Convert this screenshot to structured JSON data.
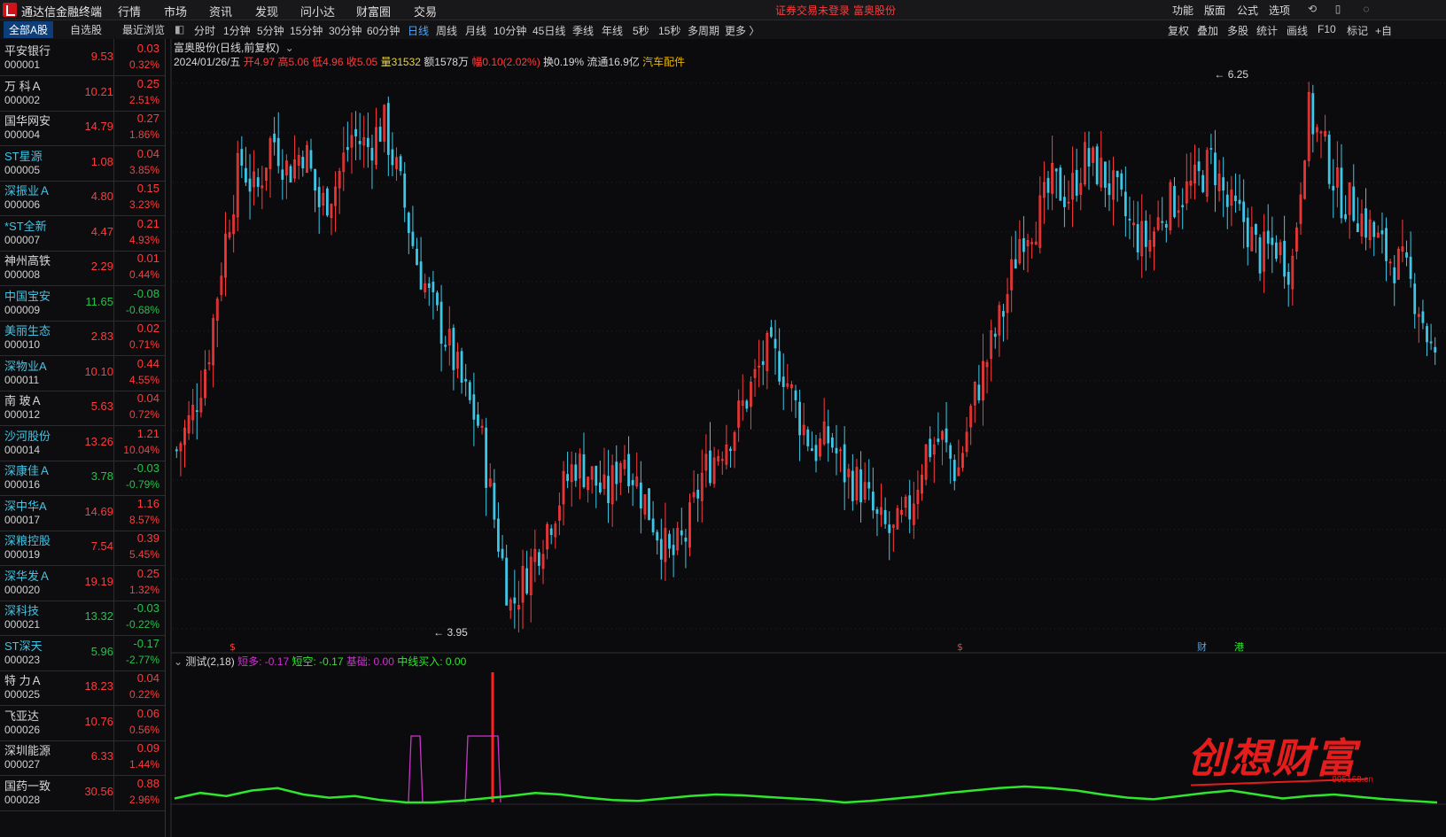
{
  "app": {
    "title": "通达信金融终端"
  },
  "menu": [
    "行情",
    "市场",
    "资讯",
    "发现",
    "问小达",
    "财富圈",
    "交易"
  ],
  "status": {
    "login_warning": "证券交易未登录",
    "current_stock": "富奥股份"
  },
  "right_menu": [
    "功能",
    "版面",
    "公式",
    "选项"
  ],
  "left_tabs": [
    "全部A股",
    "自选股",
    "最近浏览"
  ],
  "periods": [
    "分时",
    "1分钟",
    "5分钟",
    "15分钟",
    "30分钟",
    "60分钟",
    "日线",
    "周线",
    "月线",
    "10分钟",
    "45日线",
    "季线",
    "年线",
    "5秒",
    "15秒",
    "多周期",
    "更多 〉"
  ],
  "active_period": "日线",
  "right_tools": [
    "复权",
    "叠加",
    "多股",
    "统计",
    "画线",
    "F10",
    "标记",
    "+自"
  ],
  "stocks": [
    {
      "name": "平安银行",
      "code": "000001",
      "price": "9.53",
      "change": "0.03",
      "pct": "0.32%",
      "dir": "up",
      "name_color": "white"
    },
    {
      "name": "万 科Ａ",
      "code": "000002",
      "price": "10.21",
      "change": "0.25",
      "pct": "2.51%",
      "dir": "up",
      "name_color": "white"
    },
    {
      "name": "国华网安",
      "code": "000004",
      "price": "14.79",
      "change": "0.27",
      "pct": "1.86%",
      "dir": "up",
      "name_color": "white"
    },
    {
      "name": "ST星源",
      "code": "000005",
      "price": "1.08",
      "change": "0.04",
      "pct": "3.85%",
      "dir": "up",
      "name_color": "cyan"
    },
    {
      "name": "深振业Ａ",
      "code": "000006",
      "price": "4.80",
      "change": "0.15",
      "pct": "3.23%",
      "dir": "up",
      "name_color": "cyan"
    },
    {
      "name": "*ST全新",
      "code": "000007",
      "price": "4.47",
      "change": "0.21",
      "pct": "4.93%",
      "dir": "up",
      "name_color": "cyan"
    },
    {
      "name": "神州高铁",
      "code": "000008",
      "price": "2.29",
      "change": "0.01",
      "pct": "0.44%",
      "dir": "up",
      "name_color": "white"
    },
    {
      "name": "中国宝安",
      "code": "000009",
      "price": "11.65",
      "change": "-0.08",
      "pct": "-0.68%",
      "dir": "dn",
      "name_color": "cyan"
    },
    {
      "name": "美丽生态",
      "code": "000010",
      "price": "2.83",
      "change": "0.02",
      "pct": "0.71%",
      "dir": "up",
      "name_color": "cyan"
    },
    {
      "name": "深物业A",
      "code": "000011",
      "price": "10.10",
      "change": "0.44",
      "pct": "4.55%",
      "dir": "up",
      "name_color": "cyan"
    },
    {
      "name": "南 玻Ａ",
      "code": "000012",
      "price": "5.63",
      "change": "0.04",
      "pct": "0.72%",
      "dir": "up",
      "name_color": "white"
    },
    {
      "name": "沙河股份",
      "code": "000014",
      "price": "13.26",
      "change": "1.21",
      "pct": "10.04%",
      "dir": "up",
      "name_color": "cyan"
    },
    {
      "name": "深康佳Ａ",
      "code": "000016",
      "price": "3.78",
      "change": "-0.03",
      "pct": "-0.79%",
      "dir": "dn",
      "name_color": "cyan"
    },
    {
      "name": "深中华A",
      "code": "000017",
      "price": "14.69",
      "change": "1.16",
      "pct": "8.57%",
      "dir": "up",
      "name_color": "cyan"
    },
    {
      "name": "深粮控股",
      "code": "000019",
      "price": "7.54",
      "change": "0.39",
      "pct": "5.45%",
      "dir": "up",
      "name_color": "cyan"
    },
    {
      "name": "深华发Ａ",
      "code": "000020",
      "price": "19.19",
      "change": "0.25",
      "pct": "1.32%",
      "dir": "up",
      "name_color": "cyan"
    },
    {
      "name": "深科技",
      "code": "000021",
      "price": "13.32",
      "change": "-0.03",
      "pct": "-0.22%",
      "dir": "dn",
      "name_color": "cyan"
    },
    {
      "name": "ST深天",
      "code": "000023",
      "price": "5.96",
      "change": "-0.17",
      "pct": "-2.77%",
      "dir": "dn",
      "name_color": "cyan"
    },
    {
      "name": "特 力Ａ",
      "code": "000025",
      "price": "18.23",
      "change": "0.04",
      "pct": "0.22%",
      "dir": "up",
      "name_color": "white"
    },
    {
      "name": "飞亚达",
      "code": "000026",
      "price": "10.76",
      "change": "0.06",
      "pct": "0.56%",
      "dir": "up",
      "name_color": "white"
    },
    {
      "name": "深圳能源",
      "code": "000027",
      "price": "6.33",
      "change": "0.09",
      "pct": "1.44%",
      "dir": "up",
      "name_color": "white"
    },
    {
      "name": "国药一致",
      "code": "000028",
      "price": "30.56",
      "change": "0.88",
      "pct": "2.96%",
      "dir": "up",
      "name_color": "white"
    }
  ],
  "chart_header": {
    "title": "富奥股份(日线,前复权)",
    "date": "2024/01/26/五",
    "open": "开4.97",
    "high": "高5.06",
    "low": "低4.96",
    "close": "收5.05",
    "volume": "量31532",
    "amount": "额1578万",
    "range": "幅0.10(2.02%)",
    "turnover": "换0.19%",
    "float": "流通16.9亿",
    "sector": "汽车配件"
  },
  "price_annotations": {
    "high_label": "6.25",
    "low_label": "3.95"
  },
  "markers": [
    "$",
    "$",
    "财",
    "港"
  ],
  "indicator": {
    "name": "测试(2,18)",
    "duo": "短多: -0.17",
    "kong": "短空: -0.17",
    "base": "基础: 0.00",
    "mid": "中线买入: 0.00"
  },
  "watermark": {
    "text": "创想财富",
    "url": "995168.cn"
  },
  "colors": {
    "up": "#ff3b3b",
    "down": "#3fc6e6",
    "indicator_green": "#2ee62e",
    "indicator_magenta": "#cc33cc",
    "accent_blue": "#4aa8ff"
  },
  "chart_data": {
    "type": "candlestick",
    "title": "富奥股份(日线,前复权)",
    "ylim": [
      3.95,
      6.25
    ],
    "close_series": [
      4.7,
      4.85,
      5.1,
      5.55,
      5.9,
      5.75,
      6.0,
      5.85,
      5.95,
      5.7,
      5.8,
      6.0,
      5.95,
      6.05,
      5.8,
      5.5,
      5.3,
      5.15,
      4.95,
      4.8,
      4.4,
      4.05,
      4.2,
      4.35,
      4.5,
      4.65,
      4.6,
      4.5,
      4.7,
      4.55,
      4.4,
      4.25,
      4.35,
      4.6,
      4.7,
      4.8,
      4.95,
      5.1,
      5.05,
      4.85,
      4.7,
      4.75,
      4.6,
      4.55,
      4.4,
      4.35,
      4.45,
      4.7,
      4.75,
      4.6,
      4.9,
      5.1,
      5.3,
      5.6,
      5.65,
      5.8,
      5.75,
      5.9,
      5.85,
      5.75,
      5.6,
      5.55,
      5.7,
      5.75,
      5.8,
      5.9,
      5.7,
      5.65,
      5.5,
      5.55,
      5.45,
      6.1,
      5.95,
      5.75,
      5.7,
      5.6,
      5.5,
      5.45,
      5.3,
      5.05
    ],
    "indicator_green": [
      0.05,
      0.12,
      0.08,
      0.15,
      0.18,
      0.1,
      0.06,
      0.08,
      0.03,
      0.0,
      0.0,
      0.02,
      0.05,
      0.08,
      0.12,
      0.1,
      0.06,
      0.03,
      0.02,
      0.05,
      0.08,
      0.1,
      0.09,
      0.07,
      0.05,
      0.03,
      0.0,
      0.02,
      0.05,
      0.08,
      0.12,
      0.15,
      0.18,
      0.2,
      0.18,
      0.15,
      0.1,
      0.06,
      0.04,
      0.08,
      0.12,
      0.15,
      0.1,
      0.05,
      0.08,
      0.1,
      0.07,
      0.04,
      0.02,
      0.0
    ]
  }
}
